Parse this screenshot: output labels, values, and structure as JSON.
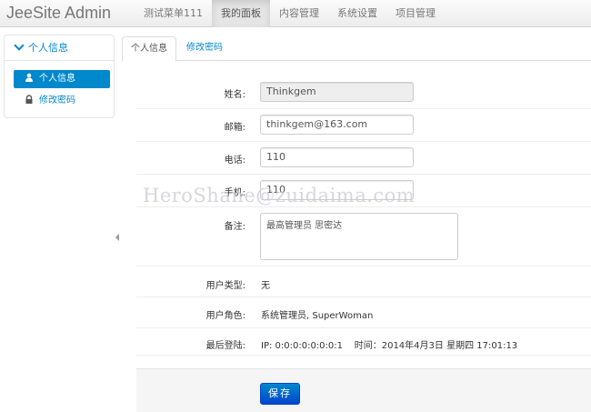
{
  "brand": "JeeSite Admin",
  "nav": [
    {
      "label": "测试菜单111"
    },
    {
      "label": "我的面板"
    },
    {
      "label": "内容管理"
    },
    {
      "label": "系统设置"
    },
    {
      "label": "项目管理"
    }
  ],
  "sidebar": {
    "header": "个人信息",
    "items": [
      {
        "label": "个人信息"
      },
      {
        "label": "修改密码"
      }
    ]
  },
  "tabs": [
    {
      "label": "个人信息"
    },
    {
      "label": "修改密码"
    }
  ],
  "form": {
    "name_label": "姓名:",
    "name_value": "Thinkgem",
    "email_label": "邮箱:",
    "email_value": "thinkgem@163.com",
    "phone_label": "电话:",
    "phone_value": "110",
    "mobile_label": "手机:",
    "mobile_value": "110",
    "remarks_label": "备注:",
    "remarks_value": "最高管理员 思密达",
    "usertype_label": "用户类型:",
    "usertype_value": "无",
    "roles_label": "用户角色:",
    "roles_value": "系统管理员, SuperWoman",
    "lastlogin_label": "最后登陆:",
    "lastlogin_value": "IP: 0:0:0:0:0:0:0:1    时间：2014年4月3日 星期四 17:01:13"
  },
  "save_label": "保存",
  "watermark": "HeroShane@zuidaima.com"
}
